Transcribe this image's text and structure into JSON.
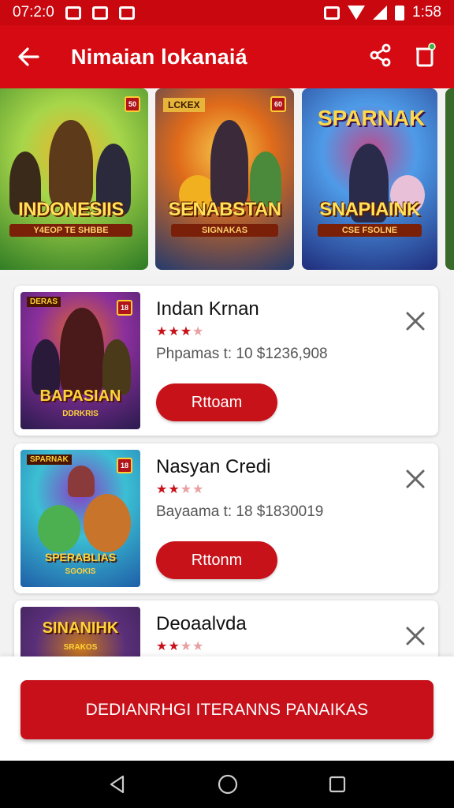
{
  "status_bar": {
    "time": "07:2:0",
    "clock_right": "1:58"
  },
  "app_bar": {
    "title": "Nimaian lokanaiá"
  },
  "carousel": [
    {
      "title": "INDONESIIS",
      "subtitle": "Y4EOP TE SHBBE",
      "badge": "50",
      "colors": [
        "#2d7a24",
        "#a7d64a",
        "#f0b32a"
      ]
    },
    {
      "top_label": "LCKEX",
      "title": "SENABSTAN",
      "subtitle": "SIGNAKAS",
      "badge": "60",
      "colors": [
        "#233a6e",
        "#e06b1a",
        "#f6c84a"
      ]
    },
    {
      "top_label": "SPARNAK",
      "title": "SNAPIAINK",
      "subtitle": "CSE FSOLNE",
      "badge": "",
      "colors": [
        "#1f2d7c",
        "#4e9be8",
        "#c04a8a"
      ]
    }
  ],
  "games": [
    {
      "name": "Indan Krnan",
      "rating": 3,
      "price": "Phpamas t: 10 $1236,908",
      "cta": "Rttoam",
      "thumb_top": "DERAS",
      "thumb_title": "BAPASIAN",
      "thumb_sub": "DDRKRIS",
      "colors": [
        "#2a1b4e",
        "#8a2f9c",
        "#e0662a"
      ]
    },
    {
      "name": "Nasyan Credi",
      "rating": 2,
      "price": "Bayaama t: 18 $1830019",
      "cta": "Rttonm",
      "thumb_top": "SPARNAK",
      "thumb_title": "SPERABLIAS",
      "thumb_sub": "SGOKIS",
      "colors": [
        "#1f5fa8",
        "#3bbfd3",
        "#8a3dc4"
      ]
    },
    {
      "name": "Deoaalvda",
      "rating": 2,
      "price": "",
      "cta": "",
      "thumb_top": "",
      "thumb_title": "SINANIHK",
      "thumb_sub": "SRAKOS",
      "colors": [
        "#2b1a3c",
        "#5a2f7a",
        "#c8791a"
      ]
    }
  ],
  "primary_action": {
    "label": "DEDIANRHGI ITERANNS PANAIKAS"
  },
  "theme": {
    "accent": "#c8101a",
    "app_bar": "#d50a12"
  },
  "icons": {
    "back": "arrow-left",
    "share": "share",
    "delete": "trash",
    "remove": "close",
    "nav_back": "triangle-left",
    "nav_home": "circle",
    "nav_recent": "square"
  }
}
